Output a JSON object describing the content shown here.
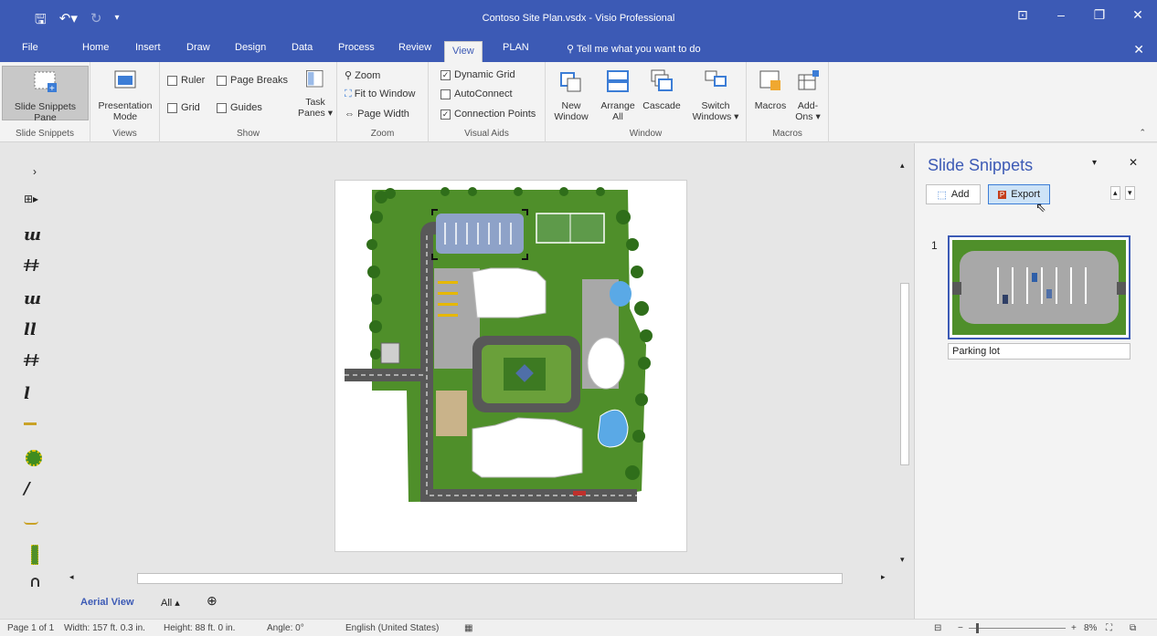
{
  "title_bar": {
    "title": "Contoso Site Plan.vsdx - Visio Professional"
  },
  "tabs": [
    "File",
    "Home",
    "Insert",
    "Draw",
    "Design",
    "Data",
    "Process",
    "Review",
    "View",
    "PLAN"
  ],
  "active_tab": "View",
  "tell_me": "Tell me what you want to do",
  "ribbon": {
    "slide_snippets": {
      "btn1": "Slide Snippets",
      "btn2": "Pane",
      "group": "Slide Snippets"
    },
    "views": {
      "btn1": "Presentation",
      "btn2": "Mode",
      "group": "Views"
    },
    "show": {
      "ruler": "Ruler",
      "page_breaks": "Page Breaks",
      "grid": "Grid",
      "guides": "Guides",
      "task1": "Task",
      "task2": "Panes",
      "group": "Show"
    },
    "zoom": {
      "zoom": "Zoom",
      "fit": "Fit to Window",
      "width": "Page Width",
      "group": "Zoom"
    },
    "visual_aids": {
      "dynamic_grid": "Dynamic Grid",
      "autoconnect": "AutoConnect",
      "connection_points": "Connection Points",
      "group": "Visual Aids"
    },
    "window": {
      "new1": "New",
      "new2": "Window",
      "arrange1": "Arrange",
      "arrange2": "All",
      "cascade": "Cascade",
      "switch1": "Switch",
      "switch2": "Windows",
      "group": "Window"
    },
    "macros": {
      "macros": "Macros",
      "addons1": "Add-",
      "addons2": "Ons",
      "group": "Macros"
    }
  },
  "panel": {
    "title": "Slide Snippets",
    "add": "Add",
    "export": "Export",
    "item_number": "1",
    "item_caption": "Parking lot"
  },
  "sheets": {
    "active": "Aerial View",
    "all": "All"
  },
  "status": {
    "page": "Page 1 of 1",
    "width": "Width: 157 ft. 0.3 in.",
    "height": "Height: 88 ft. 0 in.",
    "angle": "Angle: 0°",
    "language": "English (United States)",
    "zoom": "8%"
  },
  "colors": {
    "accent": "#3c5ab5",
    "grass": "#4f8f2a",
    "road": "#585858",
    "lot": "#a8a8a8",
    "water": "#5aa9e6"
  }
}
